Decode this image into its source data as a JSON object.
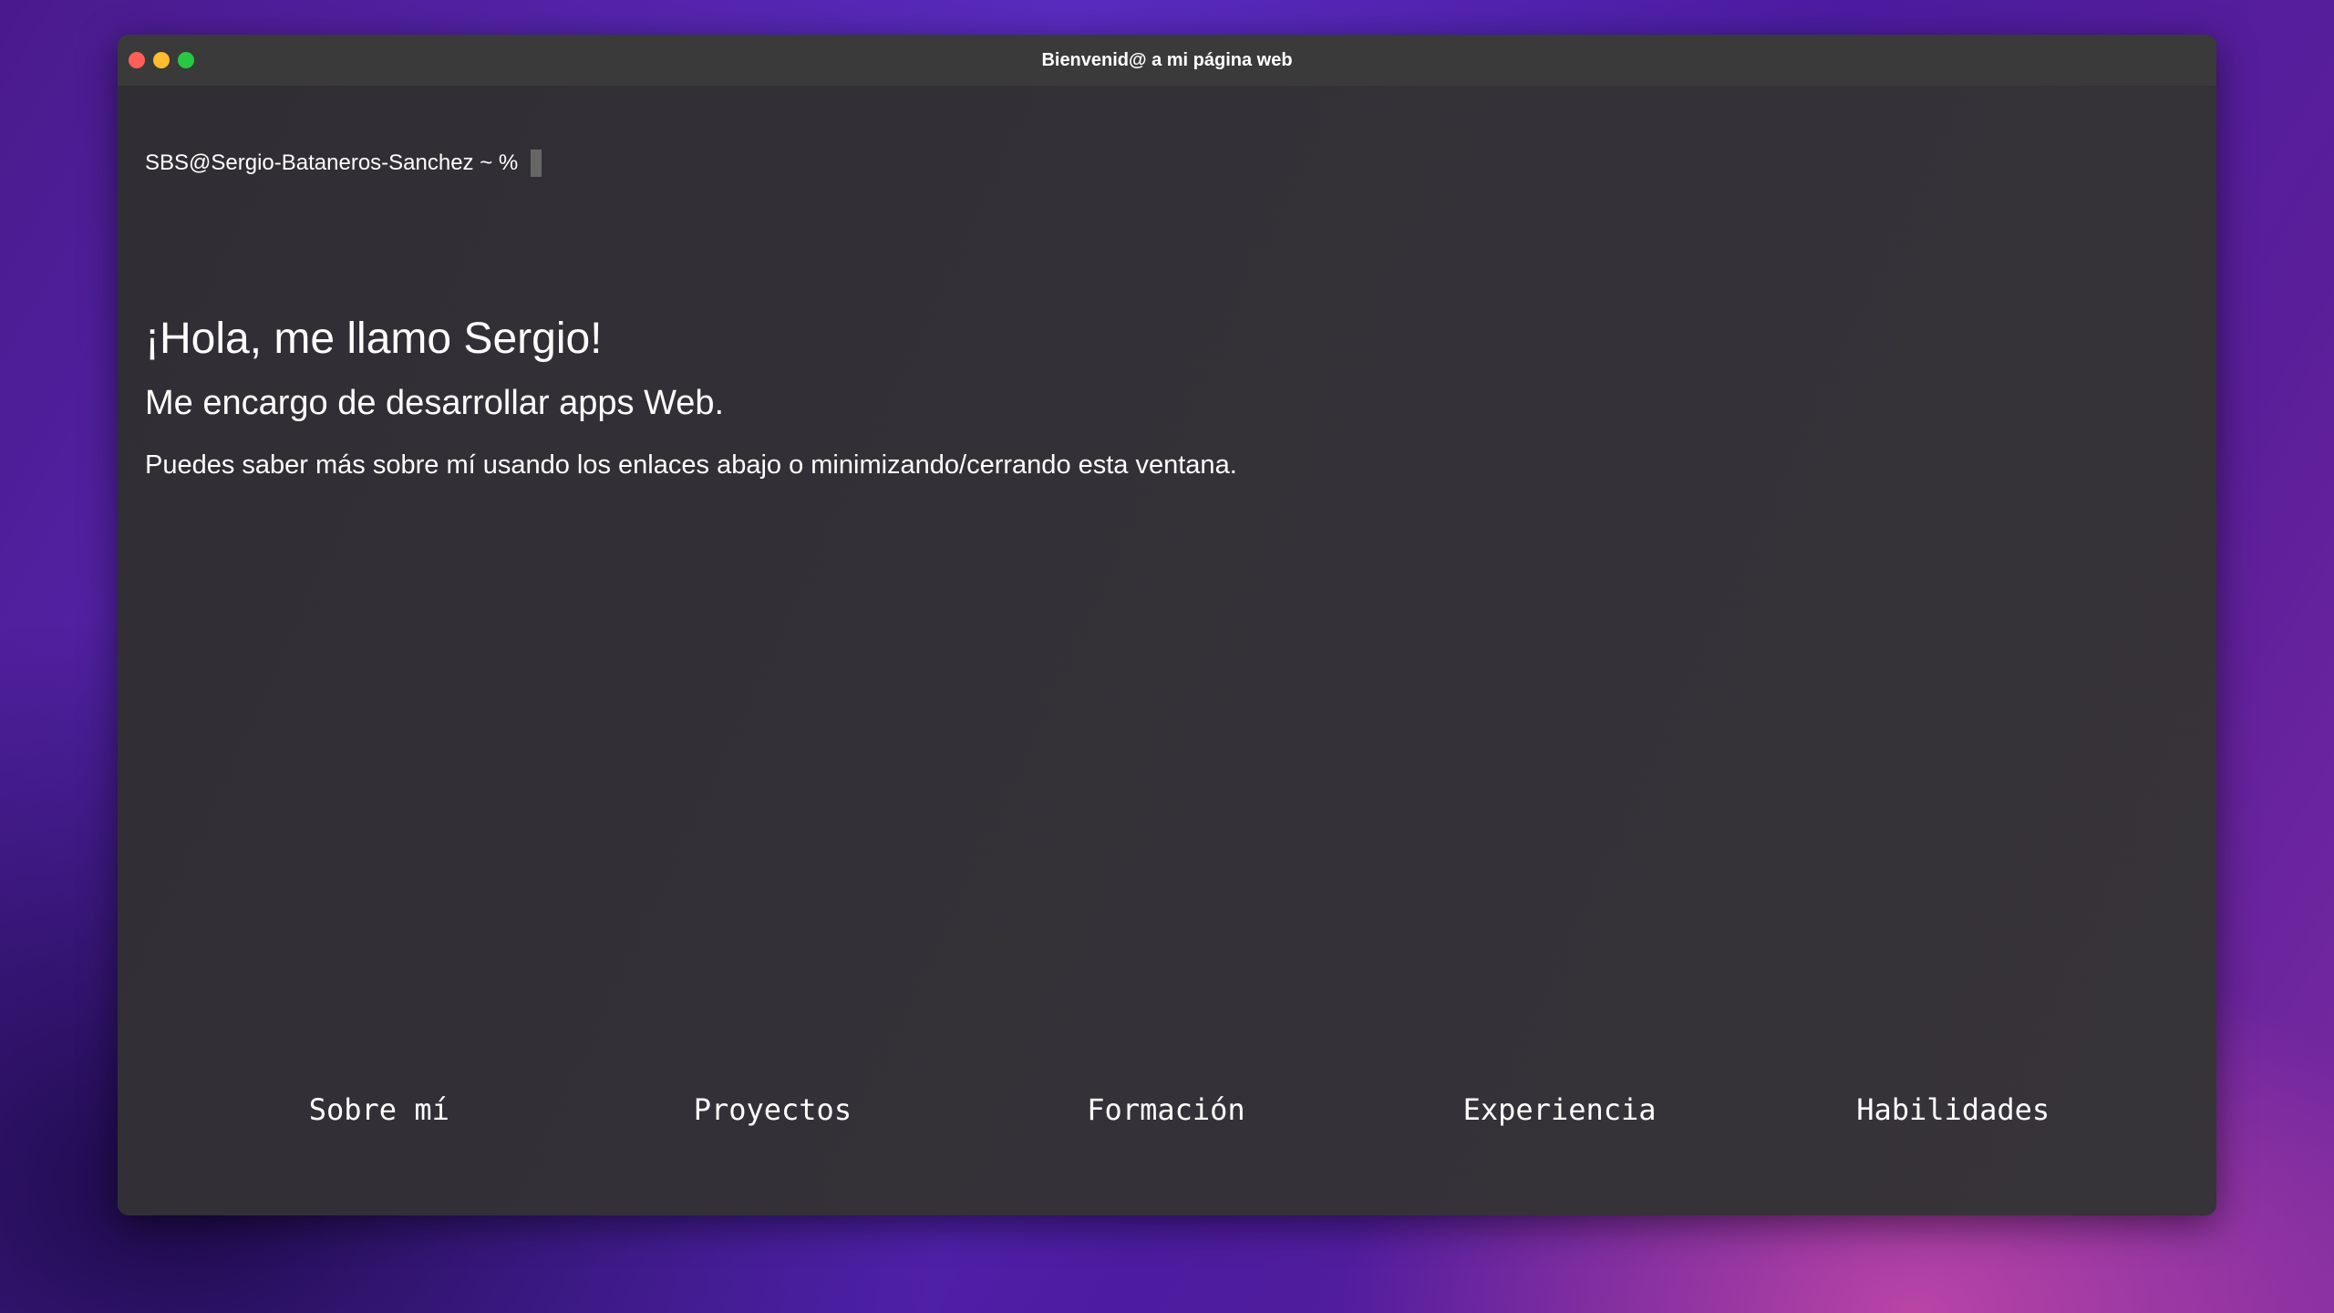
{
  "window": {
    "title": "Bienvenid@ a mi página web",
    "controls": {
      "close_color": "#ff5f57",
      "minimize_color": "#febc2e",
      "maximize_color": "#28c840"
    }
  },
  "terminal": {
    "prompt": "SBS@Sergio-Bataneros-Sanchez ~ %"
  },
  "main": {
    "heading": "¡Hola, me llamo Sergio!",
    "subheading": "Me encargo de desarrollar apps Web.",
    "description": "Puedes saber más sobre mí usando los enlaces abajo o minimizando/cerrando esta ventana."
  },
  "nav": {
    "items": [
      {
        "label": "Sobre mí"
      },
      {
        "label": "Proyectos"
      },
      {
        "label": "Formación"
      },
      {
        "label": "Experiencia"
      },
      {
        "label": "Habilidades"
      }
    ]
  }
}
